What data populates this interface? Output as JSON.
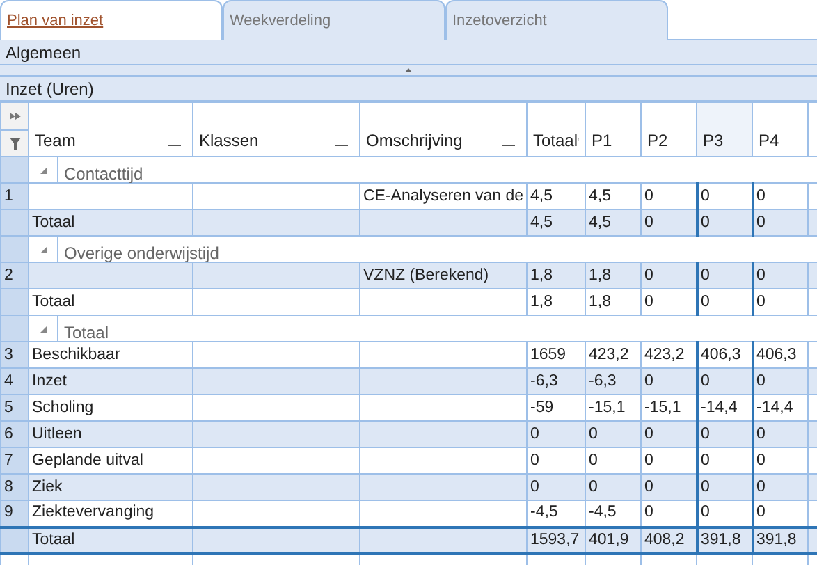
{
  "tabs": [
    {
      "label": "Plan van inzet",
      "selected": true
    },
    {
      "label": "Weekverdeling",
      "selected": false
    },
    {
      "label": "Inzetoverzicht",
      "selected": false
    }
  ],
  "sections": {
    "general": "Algemeen",
    "grid_title": "Inzet (Uren)"
  },
  "columns": [
    {
      "label": "Team",
      "grouped": true,
      "sorted": false,
      "selected": false
    },
    {
      "label": "Klassen",
      "grouped": true,
      "sorted": false,
      "selected": false
    },
    {
      "label": "Omschrijving",
      "grouped": true,
      "sorted": false,
      "selected": false
    },
    {
      "label": "Totaal",
      "grouped": false,
      "sorted": true,
      "selected": false
    },
    {
      "label": "P1",
      "grouped": false,
      "sorted": false,
      "selected": false
    },
    {
      "label": "P2",
      "grouped": false,
      "sorted": false,
      "selected": false
    },
    {
      "label": "P3",
      "grouped": false,
      "sorted": false,
      "selected": true
    },
    {
      "label": "P4",
      "grouped": false,
      "sorted": false,
      "selected": false
    }
  ],
  "rows": [
    {
      "kind": "group",
      "label": "Contacttijd"
    },
    {
      "kind": "data",
      "number": "1",
      "shaded": false,
      "cells": {
        "omschrijving": "CE-Analyseren van de",
        "values": [
          "4,5",
          "4,5",
          "0",
          "0",
          "0"
        ]
      }
    },
    {
      "kind": "subtotal",
      "shaded": true,
      "cells": {
        "team": "Totaal",
        "values": [
          "4,5",
          "4,5",
          "0",
          "0",
          "0"
        ]
      }
    },
    {
      "kind": "group",
      "label": "Overige onderwijstijd"
    },
    {
      "kind": "data",
      "number": "2",
      "shaded": true,
      "cells": {
        "omschrijving": "VZNZ (Berekend)",
        "values": [
          "1,8",
          "1,8",
          "0",
          "0",
          "0"
        ]
      }
    },
    {
      "kind": "subtotal",
      "shaded": false,
      "cells": {
        "team": "Totaal",
        "values": [
          "1,8",
          "1,8",
          "0",
          "0",
          "0"
        ]
      }
    },
    {
      "kind": "group",
      "label": "Totaal"
    },
    {
      "kind": "data",
      "number": "3",
      "shaded": false,
      "cells": {
        "team": "Beschikbaar",
        "values": [
          "1659",
          "423,2",
          "423,2",
          "406,3",
          "406,3"
        ]
      }
    },
    {
      "kind": "data",
      "number": "4",
      "shaded": true,
      "cells": {
        "team": "Inzet",
        "values": [
          "-6,3",
          "-6,3",
          "0",
          "0",
          "0"
        ]
      }
    },
    {
      "kind": "data",
      "number": "5",
      "shaded": false,
      "cells": {
        "team": "Scholing",
        "values": [
          "-59",
          "-15,1",
          "-15,1",
          "-14,4",
          "-14,4"
        ]
      }
    },
    {
      "kind": "data",
      "number": "6",
      "shaded": true,
      "cells": {
        "team": "Uitleen",
        "values": [
          "0",
          "0",
          "0",
          "0",
          "0"
        ]
      }
    },
    {
      "kind": "data",
      "number": "7",
      "shaded": false,
      "cells": {
        "team": "Geplande uitval",
        "values": [
          "0",
          "0",
          "0",
          "0",
          "0"
        ]
      }
    },
    {
      "kind": "data",
      "number": "8",
      "shaded": true,
      "cells": {
        "team": "Ziek",
        "values": [
          "0",
          "0",
          "0",
          "0",
          "0"
        ]
      }
    },
    {
      "kind": "data",
      "number": "9",
      "shaded": false,
      "cells": {
        "team": "Ziektevervanging",
        "values": [
          "-4,5",
          "-4,5",
          "0",
          "0",
          "0"
        ]
      }
    },
    {
      "kind": "grand_total",
      "shaded": true,
      "cells": {
        "team": "Totaal",
        "values": [
          "1593,7",
          "401,9",
          "408,2",
          "391,8",
          "391,8"
        ]
      }
    }
  ]
}
